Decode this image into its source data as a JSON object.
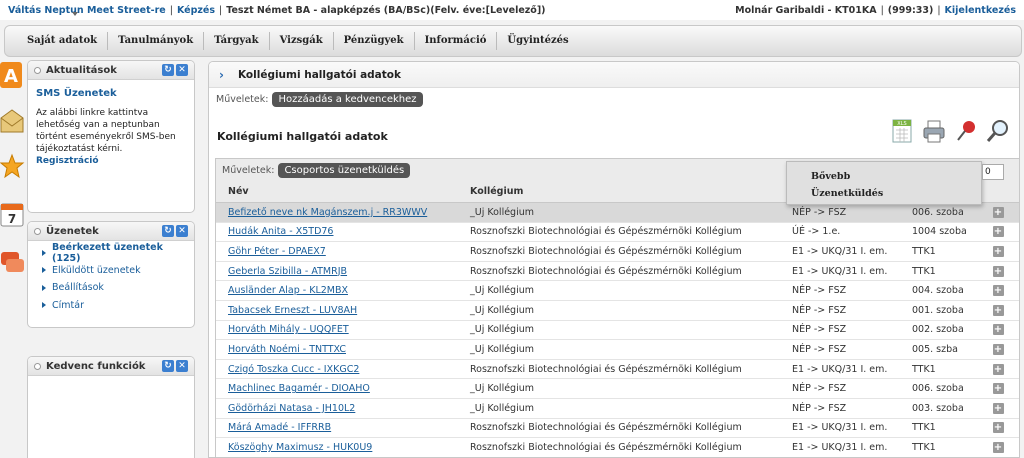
{
  "topbar": {
    "switch_link": "Váltás Neptun Meet Street-re",
    "training_link": "Képzés",
    "training_info": "Teszt Német BA - alapképzés (BA/BSc)(Felv. éve:[Levelező])",
    "user": "Molnár Garibaldi - KT01KA",
    "session": "(999:33)",
    "logout": "Kijelentkezés"
  },
  "menu": [
    "Saját adatok",
    "Tanulmányok",
    "Tárgyak",
    "Vizsgák",
    "Pénzügyek",
    "Információ",
    "Ügyintézés"
  ],
  "left_icons": [
    "info-a-icon",
    "envelope-icon",
    "star-icon",
    "calendar-icon",
    "chat-icon"
  ],
  "calendar_day": "7",
  "panels": {
    "news": {
      "title": "Aktualitások",
      "sms_title": "SMS Üzenetek",
      "sms_text": "Az alábbi linkre kattintva lehetőség van a neptunban történt eseményekről SMS-ben tájékoztatást kérni.",
      "sms_link": "Regisztráció"
    },
    "messages": {
      "title": "Üzenetek",
      "items": [
        "Beérkezett üzenetek (125)",
        "Elküldött üzenetek",
        "Beállítások",
        "Címtár"
      ]
    },
    "favorites": {
      "title": "Kedvenc funkciók"
    }
  },
  "main": {
    "title": "Kollégiumi hallgatói adatok",
    "ops_label": "Műveletek:",
    "add_fav": "Hozzáadás a kedvencekhez",
    "subtitle": "Kollégiumi hallgatói adatok",
    "grid_ops_label": "Műveletek:",
    "group_msg": "Csoportos üzenetküldés",
    "col_name": "Név",
    "col_dorm": "Kollégium",
    "popup_items": [
      "Bővebb",
      "Üzenetküldés"
    ],
    "page_size_value": "0"
  },
  "rows": [
    {
      "name": "Befizető neve nk Magánszem.j - RR3WWV",
      "dorm": "_Új Kollégium",
      "build": "NÉP -> FSZ",
      "room": "006. szoba",
      "sel": true
    },
    {
      "name": "Hudák Anita - X5TD76",
      "dorm": "Rosznofszki Biotechnológiai és Gépészmérnöki Kollégium",
      "build": "ÚÉ -> 1.e.",
      "room": "1004 szoba"
    },
    {
      "name": "Göhr Péter - DPAEX7",
      "dorm": "Rosznofszki Biotechnológiai és Gépészmérnöki Kollégium",
      "build": "E1 -> UKQ/31 I. em.",
      "room": "TTK1"
    },
    {
      "name": "Geberla Szibilla - ATMRJB",
      "dorm": "Rosznofszki Biotechnológiai és Gépészmérnöki Kollégium",
      "build": "E1 -> UKQ/31 I. em.",
      "room": "TTK1"
    },
    {
      "name": "Ausländer Alap - KL2MBX",
      "dorm": "_Új Kollégium",
      "build": "NÉP -> FSZ",
      "room": "004. szoba"
    },
    {
      "name": "Tabacsek Erneszt - LUV8AH",
      "dorm": "_Új Kollégium",
      "build": "NÉP -> FSZ",
      "room": "001. szoba"
    },
    {
      "name": "Horváth Mihály - UQQFET",
      "dorm": "_Új Kollégium",
      "build": "NÉP -> FSZ",
      "room": "002. szoba"
    },
    {
      "name": "Horváth Noémi - TNTTXC",
      "dorm": "_Új Kollégium",
      "build": "NÉP -> FSZ",
      "room": "005. szba"
    },
    {
      "name": "Czigó Toszka Cucc - IXKGC2",
      "dorm": "Rosznofszki Biotechnológiai és Gépészmérnöki Kollégium",
      "build": "E1 -> UKQ/31 I. em.",
      "room": "TTK1"
    },
    {
      "name": "Machlinec Bagamér - DIOAHO",
      "dorm": "_Új Kollégium",
      "build": "NÉP -> FSZ",
      "room": "006. szoba"
    },
    {
      "name": "Gödörházi Natasa - JH10L2",
      "dorm": "_Új Kollégium",
      "build": "NÉP -> FSZ",
      "room": "003. szoba"
    },
    {
      "name": "Márá Amadé - IFFRRB",
      "dorm": "Rosznofszki Biotechnológiai és Gépészmérnöki Kollégium",
      "build": "E1 -> UKQ/31 I. em.",
      "room": "TTK1"
    },
    {
      "name": "Köszöghy Maximusz - HUK0U9",
      "dorm": "Rosznofszki Biotechnológiai és Gépészmérnöki Kollégium",
      "build": "E1 -> UKQ/31 I. em.",
      "room": "TTK1"
    }
  ],
  "colors": {
    "link": "#1a5e9a",
    "accent": "#3b7fd0"
  }
}
